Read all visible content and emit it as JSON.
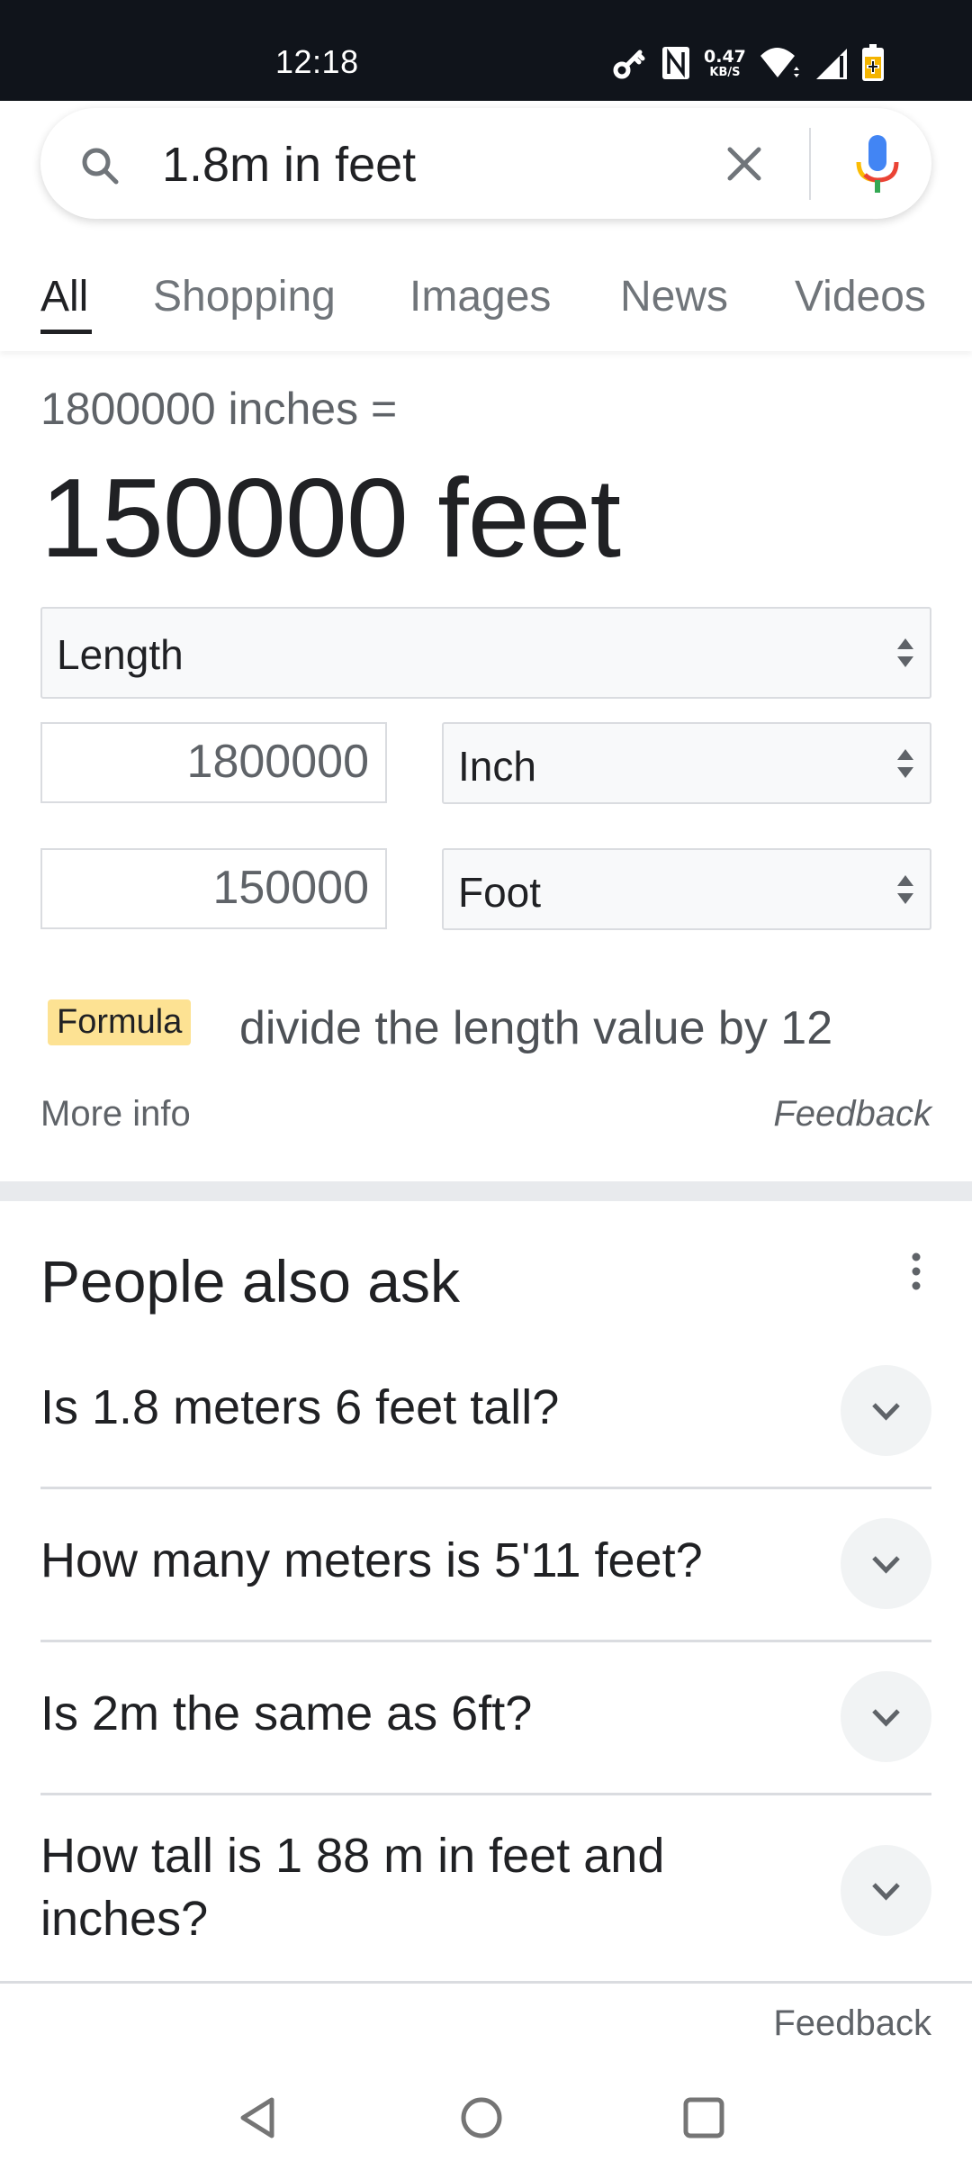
{
  "status_bar": {
    "time": "12:18",
    "network_speed_value": "0.47",
    "network_speed_unit": "KB/S",
    "icons": [
      "vpn-key-icon",
      "nfc-icon",
      "wifi-icon",
      "cellular-signal-icon",
      "battery-charging-icon"
    ]
  },
  "search": {
    "query": "1.8m in feet",
    "icons": {
      "search": "search-icon",
      "clear": "close-icon",
      "voice": "microphone-icon"
    }
  },
  "tabs": [
    {
      "label": "All",
      "active": true
    },
    {
      "label": "Shopping",
      "active": false
    },
    {
      "label": "Images",
      "active": false
    },
    {
      "label": "News",
      "active": false
    },
    {
      "label": "Videos",
      "active": false
    }
  ],
  "converter": {
    "subtitle": "1800000 inches =",
    "result": "150000 feet",
    "quantity": "Length",
    "from_value": "1800000",
    "from_unit": "Inch",
    "to_value": "150000",
    "to_unit": "Foot",
    "formula_label": "Formula",
    "formula_text": "divide the length value by 12",
    "more_info": "More info",
    "feedback": "Feedback",
    "formula_badge_color": "#fde293"
  },
  "people_also_ask": {
    "title": "People also ask",
    "questions": [
      "Is 1.8 meters 6 feet tall?",
      "How many meters is 5'11 feet?",
      "Is 2m the same as 6ft?",
      "How tall is 1 88 m in feet and inches?"
    ]
  },
  "footer": {
    "feedback": "Feedback"
  },
  "nav_bar": {
    "buttons": [
      "back-icon",
      "home-icon",
      "recents-icon"
    ]
  }
}
